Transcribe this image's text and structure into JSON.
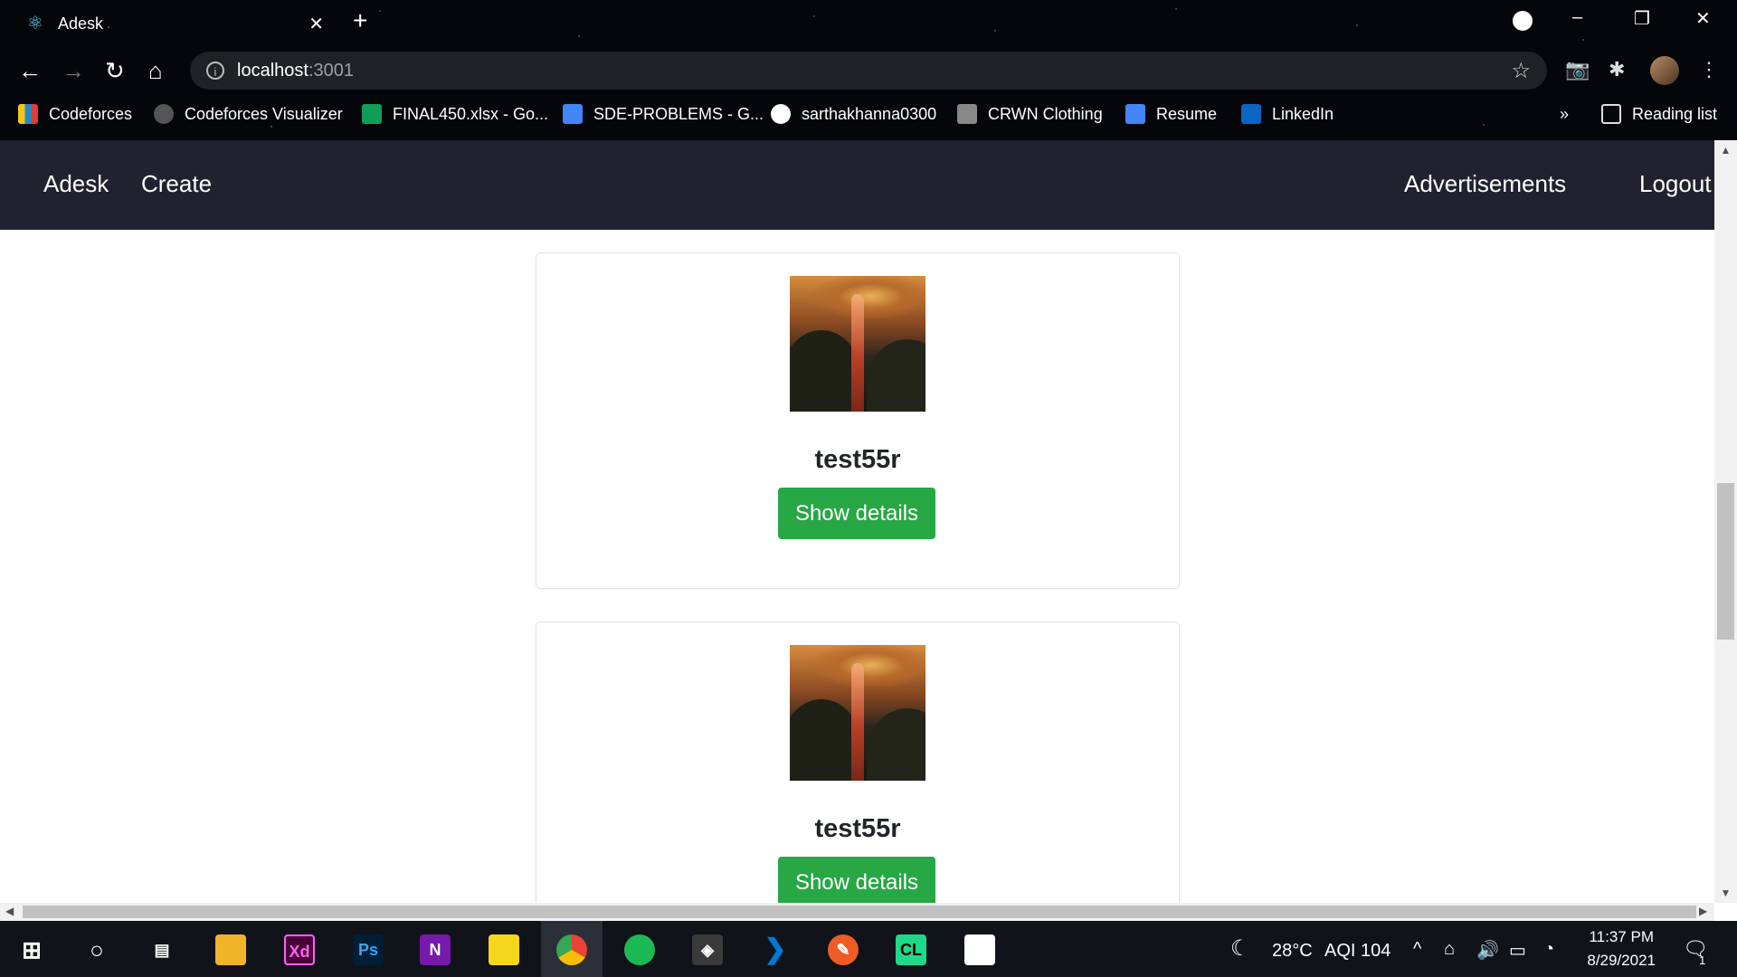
{
  "browser": {
    "tab_title": "Adesk",
    "tab_close": "✕",
    "new_tab": "+",
    "url_host": "localhost",
    "url_port": ":3001",
    "bookmarks": [
      {
        "label": "Codeforces",
        "icon_color": "#1f8acb"
      },
      {
        "label": "Codeforces Visualizer",
        "icon_color": "#555555"
      },
      {
        "label": "FINAL450.xlsx - Go...",
        "icon_color": "#0f9d58"
      },
      {
        "label": "SDE-PROBLEMS - G...",
        "icon_color": "#4285f4"
      },
      {
        "label": "sarthakhanna0300",
        "icon_color": "#ffffff"
      },
      {
        "label": "CRWN Clothing",
        "icon_color": "#888888"
      },
      {
        "label": "Resume",
        "icon_color": "#4285f4"
      },
      {
        "label": "LinkedIn",
        "icon_color": "#0a66c2"
      }
    ],
    "overflow": "»",
    "reading_list": "Reading list"
  },
  "app_nav": {
    "brand": "Adesk",
    "create": "Create",
    "advertisements": "Advertisements",
    "logout": "Logout"
  },
  "cards": [
    {
      "title": "test55r",
      "button": "Show details"
    },
    {
      "title": "test55r",
      "button": "Show details"
    }
  ],
  "taskbar": {
    "weather": "28°C",
    "aqi": "AQI 104",
    "time": "11:37 PM",
    "date": "8/29/2021",
    "notification_count": "1",
    "apps": [
      "Xd",
      "Ps",
      "N",
      "CL"
    ]
  },
  "colors": {
    "navbar": "#21222f",
    "success": "#28a745"
  }
}
